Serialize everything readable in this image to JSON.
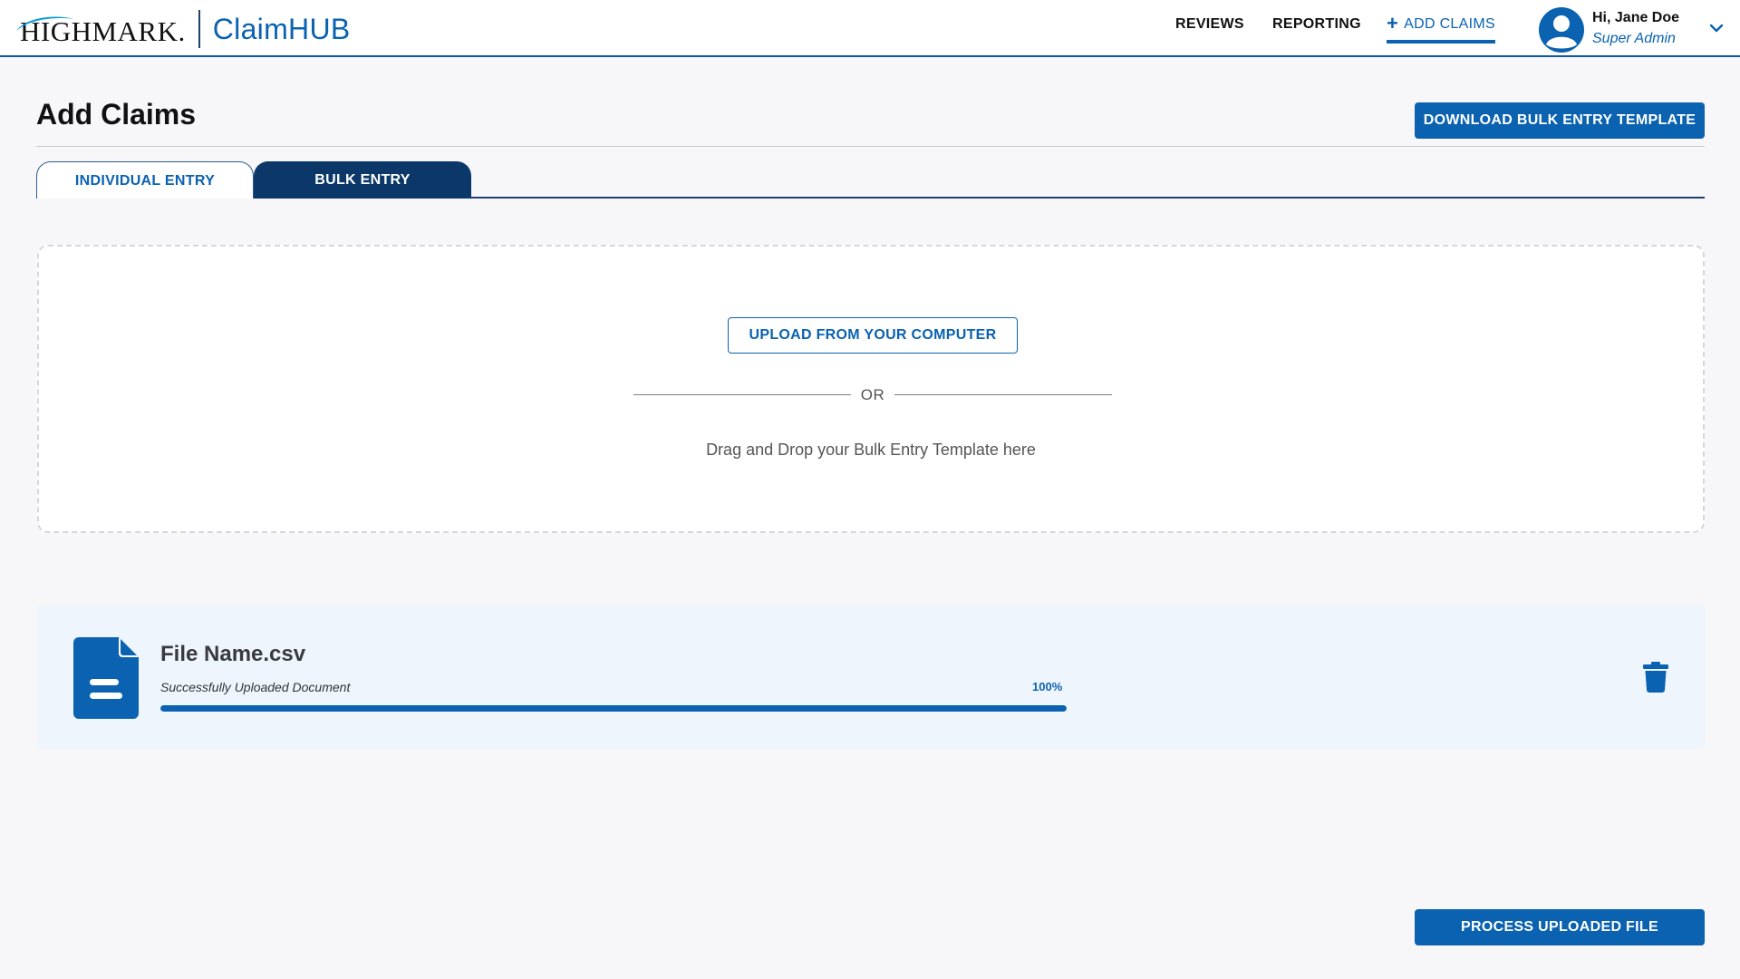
{
  "header": {
    "logo_text": "HIGHMARK.",
    "product_name": "ClaimHUB",
    "nav": [
      {
        "label": "REVIEWS",
        "active": false
      },
      {
        "label": "REPORTING",
        "active": false
      },
      {
        "label": "ADD CLAIMS",
        "active": true,
        "icon": "plus-icon"
      }
    ],
    "user": {
      "greeting": "Hi, Jane Doe",
      "role": "Super Admin",
      "icon": "user-avatar-icon"
    }
  },
  "page": {
    "title": "Add Claims",
    "download_button": "DOWNLOAD BULK ENTRY TEMPLATE"
  },
  "tabs": [
    {
      "label": "INDIVIDUAL ENTRY",
      "active": false
    },
    {
      "label": "BULK ENTRY",
      "active": true
    }
  ],
  "dropzone": {
    "upload_button": "UPLOAD FROM YOUR COMPUTER",
    "or_text": "OR",
    "drop_text": "Drag and Drop your Bulk Entry Template here"
  },
  "file": {
    "name": "File Name.csv",
    "status": "Successfully Uploaded Document",
    "percent_label": "100%",
    "progress": 1.0,
    "icon": "document-icon",
    "delete_icon": "trash-icon"
  },
  "actions": {
    "process_button": "PROCESS UPLOADED FILE"
  },
  "colors": {
    "primary": "#0a62b0",
    "tab_active": "#0b3868",
    "page_bg": "#f7f6f9",
    "file_card_bg": "#eef5fd"
  }
}
